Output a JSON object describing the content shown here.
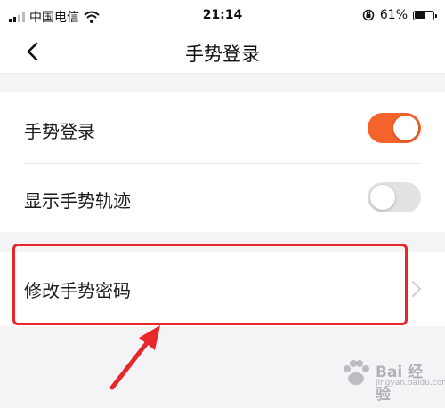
{
  "status_bar": {
    "carrier": "中国电信",
    "time": "21:14",
    "battery_percent": "61%",
    "battery_level": 0.61
  },
  "nav": {
    "title": "手势登录",
    "back_icon": "chevron-left-icon"
  },
  "settings": {
    "gesture_login": {
      "label": "手势登录",
      "enabled": true
    },
    "show_trail": {
      "label": "显示手势轨迹",
      "enabled": false
    }
  },
  "change_password": {
    "label": "修改手势密码",
    "chevron_icon": "chevron-right-icon"
  },
  "watermark": {
    "brand": "Bai 经验",
    "sub": "jingyan.baidu.com"
  },
  "colors": {
    "accent": "#f4632a",
    "toggle_off": "#e2e2e4",
    "highlight": "#e8272b"
  }
}
